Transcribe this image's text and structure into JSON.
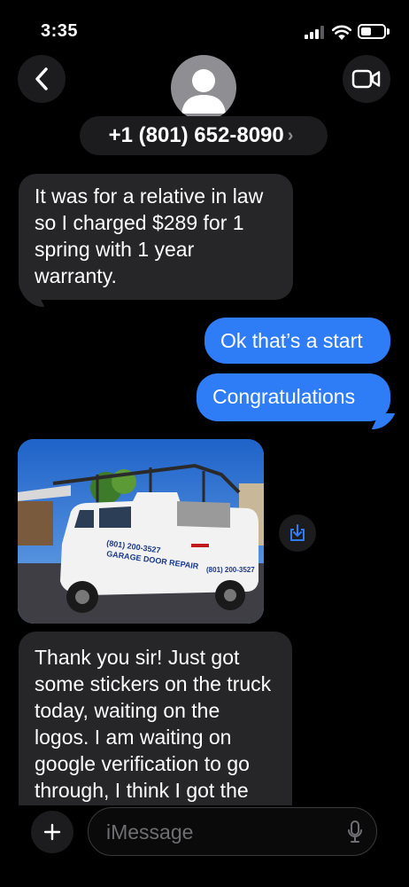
{
  "status_bar": {
    "time": "3:35",
    "battery_level": 0.45
  },
  "header": {
    "contact": "+1 (801) 652-8090",
    "chevron": "›"
  },
  "messages": [
    {
      "direction": "incoming",
      "text": "It was for a relative in law so I charged $289 for 1 spring with 1 year warranty."
    },
    {
      "direction": "outgoing",
      "text": "Ok that’s a start"
    },
    {
      "direction": "outgoing",
      "text": "Congratulations"
    },
    {
      "direction": "incoming",
      "type": "image",
      "description": "photo"
    },
    {
      "direction": "incoming",
      "text": "Thank you sir! Just got some stickers on the truck today, waiting on the logos. I am waiting on google verification to go through, I think I got the video right this time"
    }
  ],
  "compose": {
    "placeholder": "iMessage"
  },
  "truck_decal": {
    "phone": "(801) 200-3527",
    "business": "GARAGE DOOR REPAIR",
    "phone_back": "(801) 200-3527"
  },
  "colors": {
    "outgoing_bubble": "#2f7df6",
    "incoming_bubble": "#262629",
    "background": "#000000"
  },
  "icons": [
    "chevron-left-icon",
    "person-avatar-icon",
    "video-camera-icon",
    "download-icon",
    "plus-icon",
    "microphone-icon"
  ]
}
